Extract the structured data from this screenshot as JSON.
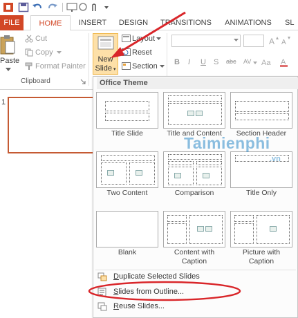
{
  "tabs": {
    "file": "FILE",
    "home": "HOME",
    "insert": "INSERT",
    "design": "DESIGN",
    "transitions": "TRANSITIONS",
    "animations": "ANIMATIONS",
    "slideshow": "SL"
  },
  "clipboard": {
    "paste": "Paste",
    "cut": "Cut",
    "copy": "Copy",
    "format_painter": "Format Painter",
    "group_label": "Clipboard"
  },
  "slides": {
    "new_slide_line1": "New",
    "new_slide_line2": "Slide",
    "layout": "Layout",
    "reset": "Reset",
    "section": "Section"
  },
  "font": {
    "bold": "B",
    "italic": "I",
    "underline": "U",
    "strikethrough": "S",
    "shadow": "abc",
    "spacing": "AV"
  },
  "thumbnail": {
    "number": "1"
  },
  "gallery": {
    "title": "Office Theme",
    "layouts": [
      {
        "caption": "Title Slide"
      },
      {
        "caption": "Title and Content"
      },
      {
        "caption": "Section Header"
      },
      {
        "caption": "Two Content"
      },
      {
        "caption": "Comparison"
      },
      {
        "caption": "Title Only"
      },
      {
        "caption": "Blank"
      },
      {
        "caption_line1": "Content with",
        "caption_line2": "Caption"
      },
      {
        "caption_line1": "Picture with",
        "caption_line2": "Caption"
      }
    ],
    "menu": {
      "duplicate_u": "D",
      "duplicate": "uplicate Selected Slides",
      "outline_u": "S",
      "outline": "lides from Outline...",
      "reuse_u": "R",
      "reuse": "euse Slides..."
    }
  },
  "watermark": {
    "text": "Taimienphi",
    "sub": ".vn"
  },
  "colors": {
    "accent": "#d24726",
    "annotation_red": "#d9262a",
    "watermark": "#2e8bc8"
  }
}
